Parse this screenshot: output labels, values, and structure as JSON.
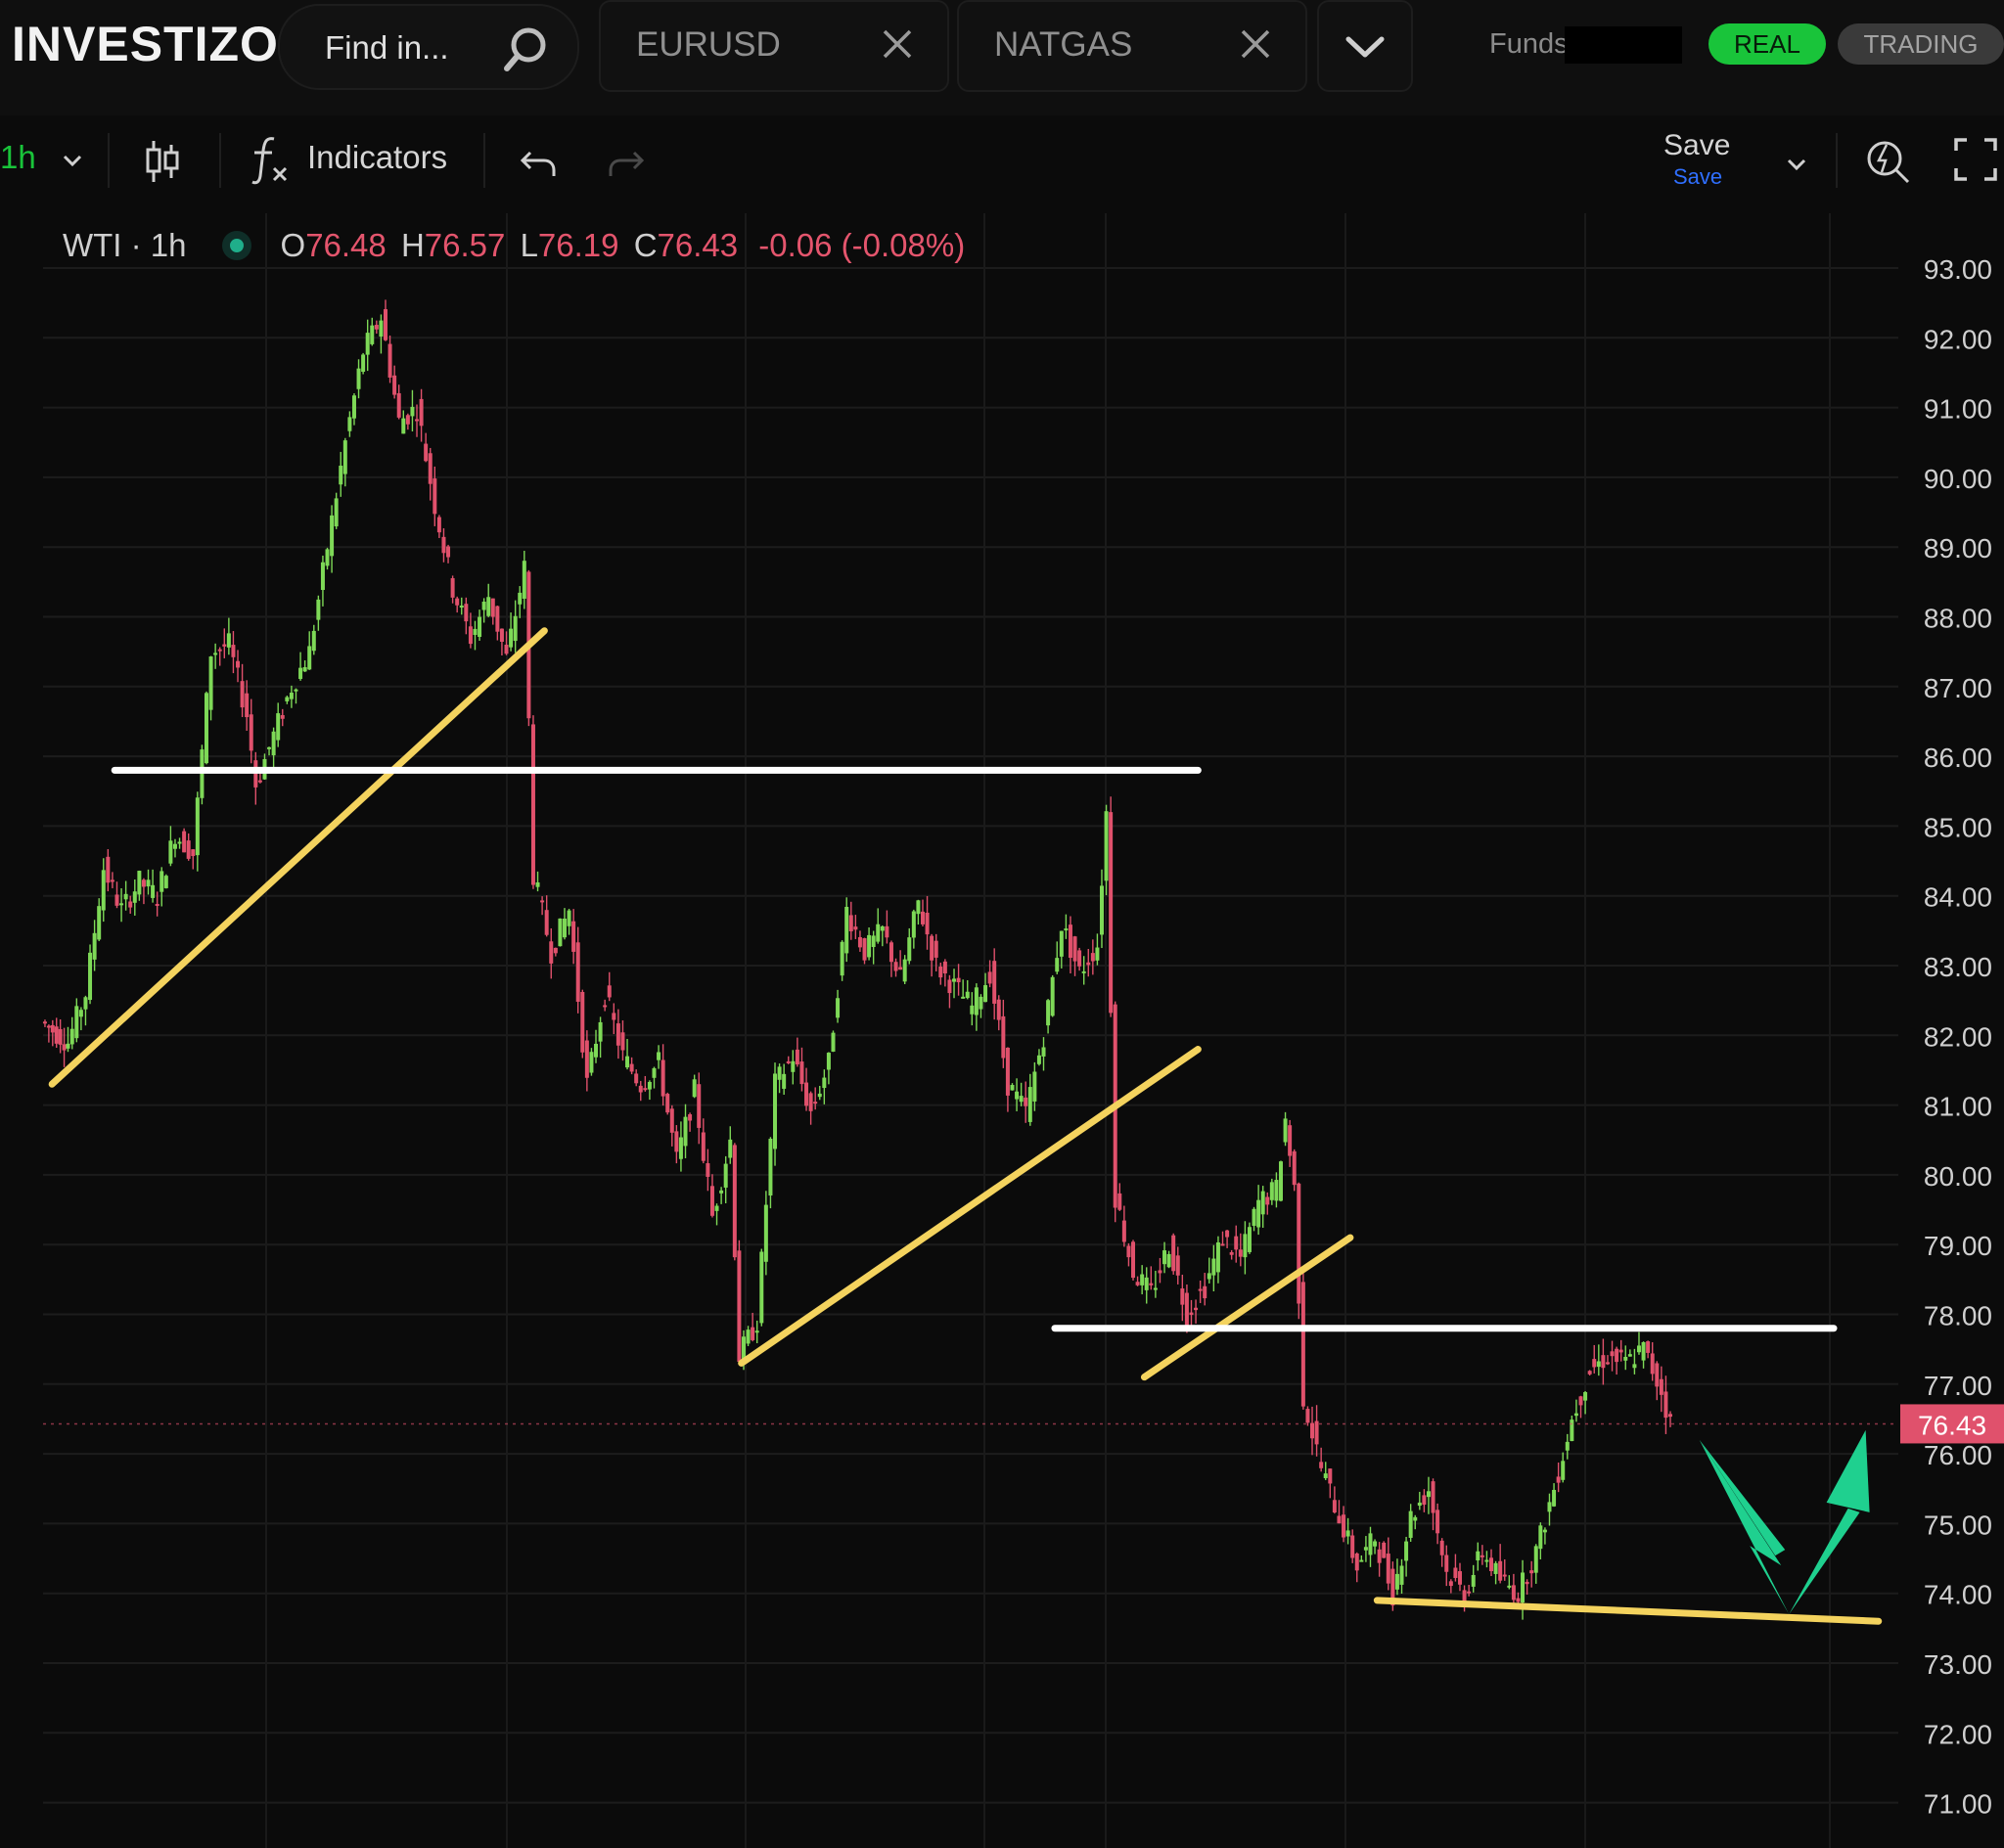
{
  "app": {
    "logo": "INVESTIZO"
  },
  "header": {
    "search_placeholder": "Find in...",
    "tabs": [
      {
        "label": "EURUSD"
      },
      {
        "label": "NATGAS"
      }
    ],
    "funds_label": "Funds",
    "mode_real": "REAL",
    "mode_trading": "TRADING"
  },
  "toolbar": {
    "interval": "1h",
    "indicators_label": "Indicators",
    "save_label": "Save",
    "save_sub": "Save"
  },
  "legend": {
    "symbol": "WTI · 1h",
    "o_key": "O",
    "o_val": "76.48",
    "h_key": "H",
    "h_val": "76.57",
    "l_key": "L",
    "l_val": "76.19",
    "c_key": "C",
    "c_val": "76.43",
    "change": "-0.06 (-0.08%)"
  },
  "colors": {
    "up": "#7ed957",
    "down": "#e0516c",
    "accent_green": "#19c43a",
    "trendline_yellow": "#f4d35e",
    "level_white": "#ffffff",
    "arrow": "#1fd08f"
  },
  "chart_data": {
    "type": "line",
    "title": "",
    "symbol": "WTI",
    "interval": "1h",
    "ylim": [
      70.4,
      94.5
    ],
    "yticks": [
      "93.00",
      "92.00",
      "91.00",
      "90.00",
      "89.00",
      "88.00",
      "87.00",
      "86.00",
      "85.00",
      "84.00",
      "83.00",
      "82.00",
      "81.00",
      "80.00",
      "79.00",
      "78.00",
      "77.00",
      "76.00",
      "75.00",
      "74.00",
      "73.00",
      "72.00",
      "71.00"
    ],
    "last_price": "76.43",
    "last_price_value": 76.43,
    "grid": true,
    "price_path": [
      {
        "x": 0,
        "y": 82.2
      },
      {
        "x": 3,
        "y": 81.9
      },
      {
        "x": 5,
        "y": 82.6
      },
      {
        "x": 7,
        "y": 84.4
      },
      {
        "x": 9,
        "y": 83.8
      },
      {
        "x": 11,
        "y": 84.2
      },
      {
        "x": 13,
        "y": 84.0
      },
      {
        "x": 15,
        "y": 84.9
      },
      {
        "x": 17,
        "y": 84.6
      },
      {
        "x": 19,
        "y": 87.5
      },
      {
        "x": 21,
        "y": 87.6
      },
      {
        "x": 23,
        "y": 86.6
      },
      {
        "x": 24,
        "y": 85.6
      },
      {
        "x": 26,
        "y": 86.3
      },
      {
        "x": 28,
        "y": 87.0
      },
      {
        "x": 30,
        "y": 87.5
      },
      {
        "x": 32,
        "y": 89.0
      },
      {
        "x": 34,
        "y": 90.5
      },
      {
        "x": 36,
        "y": 91.8
      },
      {
        "x": 38,
        "y": 92.3
      },
      {
        "x": 40,
        "y": 90.8
      },
      {
        "x": 42,
        "y": 91.0
      },
      {
        "x": 44,
        "y": 89.6
      },
      {
        "x": 46,
        "y": 88.4
      },
      {
        "x": 48,
        "y": 87.7
      },
      {
        "x": 50,
        "y": 88.3
      },
      {
        "x": 52,
        "y": 87.4
      },
      {
        "x": 54,
        "y": 88.7
      },
      {
        "x": 55,
        "y": 84.3
      },
      {
        "x": 57,
        "y": 83.2
      },
      {
        "x": 59,
        "y": 83.8
      },
      {
        "x": 61,
        "y": 81.3
      },
      {
        "x": 63,
        "y": 82.6
      },
      {
        "x": 65,
        "y": 81.7
      },
      {
        "x": 67,
        "y": 81.3
      },
      {
        "x": 69,
        "y": 81.6
      },
      {
        "x": 71,
        "y": 80.2
      },
      {
        "x": 73,
        "y": 81.2
      },
      {
        "x": 75,
        "y": 79.4
      },
      {
        "x": 77,
        "y": 80.5
      },
      {
        "x": 78,
        "y": 77.4
      },
      {
        "x": 80,
        "y": 77.9
      },
      {
        "x": 82,
        "y": 81.3
      },
      {
        "x": 84,
        "y": 81.7
      },
      {
        "x": 86,
        "y": 80.9
      },
      {
        "x": 88,
        "y": 81.6
      },
      {
        "x": 90,
        "y": 83.8
      },
      {
        "x": 92,
        "y": 83.2
      },
      {
        "x": 94,
        "y": 83.5
      },
      {
        "x": 96,
        "y": 82.8
      },
      {
        "x": 98,
        "y": 83.9
      },
      {
        "x": 100,
        "y": 83.0
      },
      {
        "x": 102,
        "y": 82.7
      },
      {
        "x": 104,
        "y": 82.4
      },
      {
        "x": 106,
        "y": 82.9
      },
      {
        "x": 108,
        "y": 81.3
      },
      {
        "x": 110,
        "y": 80.9
      },
      {
        "x": 112,
        "y": 82.0
      },
      {
        "x": 114,
        "y": 83.6
      },
      {
        "x": 116,
        "y": 82.9
      },
      {
        "x": 118,
        "y": 83.3
      },
      {
        "x": 119,
        "y": 85.2
      },
      {
        "x": 120,
        "y": 79.7
      },
      {
        "x": 122,
        "y": 78.6
      },
      {
        "x": 124,
        "y": 78.3
      },
      {
        "x": 126,
        "y": 79.0
      },
      {
        "x": 128,
        "y": 78.0
      },
      {
        "x": 130,
        "y": 78.4
      },
      {
        "x": 132,
        "y": 79.1
      },
      {
        "x": 134,
        "y": 78.8
      },
      {
        "x": 136,
        "y": 79.6
      },
      {
        "x": 138,
        "y": 79.8
      },
      {
        "x": 139,
        "y": 80.8
      },
      {
        "x": 140,
        "y": 79.8
      },
      {
        "x": 141,
        "y": 76.8
      },
      {
        "x": 143,
        "y": 75.8
      },
      {
        "x": 145,
        "y": 75.1
      },
      {
        "x": 147,
        "y": 74.4
      },
      {
        "x": 149,
        "y": 74.8
      },
      {
        "x": 151,
        "y": 74.0
      },
      {
        "x": 153,
        "y": 75.1
      },
      {
        "x": 155,
        "y": 75.5
      },
      {
        "x": 157,
        "y": 74.3
      },
      {
        "x": 159,
        "y": 74.0
      },
      {
        "x": 161,
        "y": 74.6
      },
      {
        "x": 163,
        "y": 74.2
      },
      {
        "x": 165,
        "y": 74.0
      },
      {
        "x": 167,
        "y": 74.6
      },
      {
        "x": 169,
        "y": 75.5
      },
      {
        "x": 171,
        "y": 76.5
      },
      {
        "x": 173,
        "y": 77.2
      },
      {
        "x": 175,
        "y": 77.4
      },
      {
        "x": 177,
        "y": 77.3
      },
      {
        "x": 179,
        "y": 77.5
      },
      {
        "x": 181,
        "y": 76.9
      },
      {
        "x": 182,
        "y": 76.43
      }
    ],
    "annotations": [
      {
        "type": "trendline",
        "color": "yellow",
        "from": {
          "x": 1,
          "y": 81.3
        },
        "to": {
          "x": 56,
          "y": 87.8
        }
      },
      {
        "type": "level",
        "color": "white",
        "from": {
          "x": 8,
          "y": 85.8
        },
        "to": {
          "x": 129,
          "y": 85.8
        }
      },
      {
        "type": "trendline",
        "color": "yellow",
        "from": {
          "x": 78,
          "y": 77.3
        },
        "to": {
          "x": 129,
          "y": 81.8
        }
      },
      {
        "type": "trendline",
        "color": "yellow",
        "from": {
          "x": 123,
          "y": 77.1
        },
        "to": {
          "x": 146,
          "y": 79.1
        }
      },
      {
        "type": "level",
        "color": "white",
        "from": {
          "x": 113,
          "y": 77.8
        },
        "to": {
          "x": 200,
          "y": 77.8
        }
      },
      {
        "type": "trendline",
        "color": "yellow",
        "from": {
          "x": 149,
          "y": 73.9
        },
        "to": {
          "x": 205,
          "y": 73.6
        }
      },
      {
        "type": "arrow",
        "direction": "down-up",
        "from": {
          "x": 185,
          "y": 76.2
        },
        "via": {
          "x": 195,
          "y": 73.7
        },
        "to": {
          "x": 204,
          "y": 76.2
        }
      }
    ]
  }
}
